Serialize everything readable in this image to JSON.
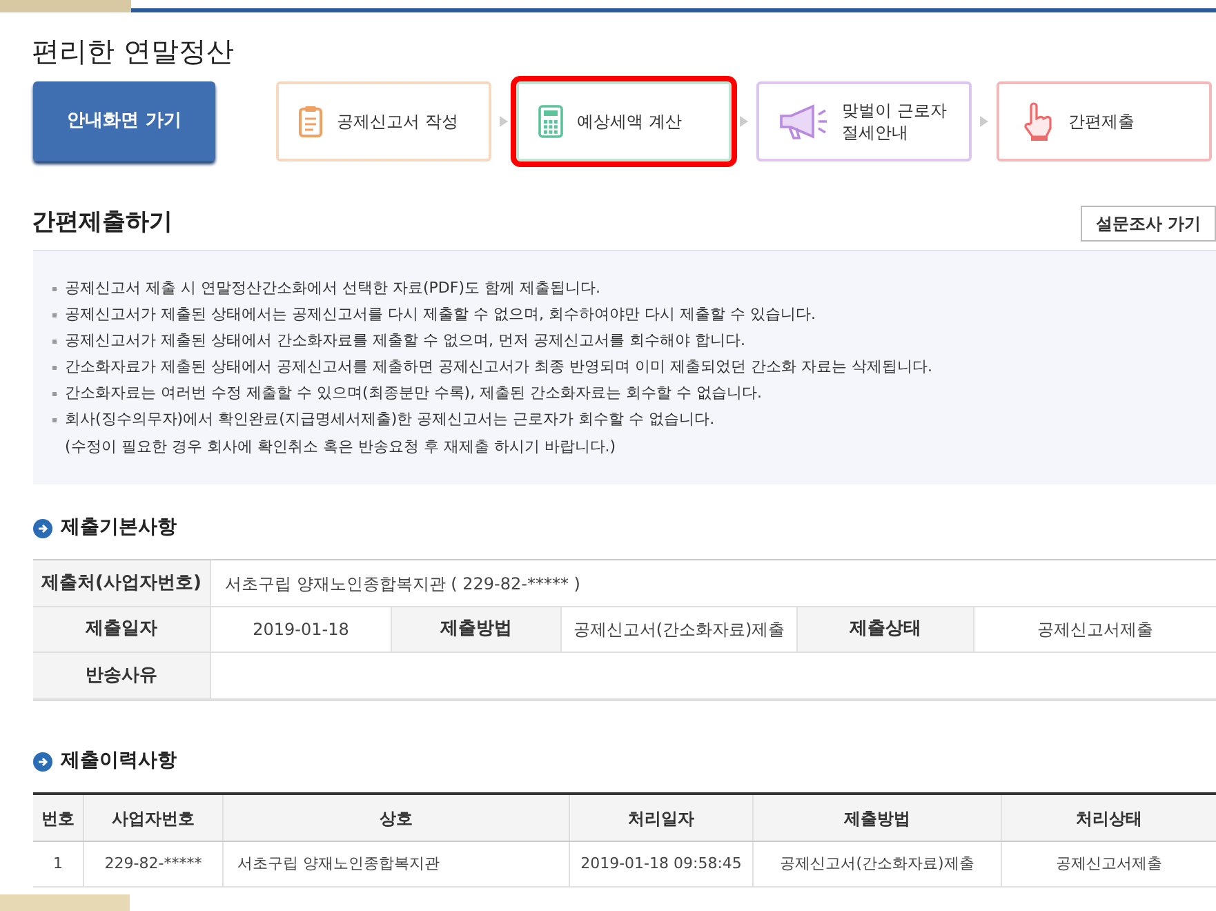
{
  "page_title": "편리한 연말정산",
  "home_button": "안내화면 가기",
  "steps": [
    {
      "label": "공제신고서 작성",
      "kind": "clipboard",
      "color": "#f7d9bf",
      "selected": false
    },
    {
      "label": "예상세액 계산",
      "kind": "calculator",
      "color": "#bfe6d4",
      "selected": true
    },
    {
      "label": "맞벌이 근로자\n절세안내",
      "kind": "megaphone",
      "color": "#dcc6f0",
      "selected": false
    },
    {
      "label": "간편제출",
      "kind": "hand",
      "color": "#f5b8b8",
      "selected": false
    }
  ],
  "section_title": "간편제출하기",
  "survey_button": "설문조사 가기",
  "notices": [
    "공제신고서 제출 시 연말정산간소화에서 선택한 자료(PDF)도 함께 제출됩니다.",
    "공제신고서가 제출된 상태에서는 공제신고서를 다시 제출할 수 없으며, 회수하여야만 다시 제출할 수 있습니다.",
    "공제신고서가 제출된 상태에서 간소화자료를 제출할 수 없으며, 먼저 공제신고서를 회수해야 합니다.",
    "간소화자료가 제출된 상태에서 공제신고서를 제출하면 공제신고서가 최종 반영되며 이미 제출되었던 간소화 자료는 삭제됩니다.",
    "간소화자료는 여러번 수정 제출할 수 있으며(최종분만 수록), 제출된 간소화자료는 회수할 수 없습니다.",
    "회사(징수의무자)에서 확인완료(지급명세서제출)한 공제신고서는 근로자가 회수할 수 없습니다."
  ],
  "notice_note": "(수정이 필요한 경우 회사에 확인취소 혹은 반송요청 후 재제출 하시기 바랍니다.)",
  "basic_info": {
    "title": "제출기본사항",
    "submitter_label": "제출처(사업자번호)",
    "submitter_value": "서초구립 양재노인종합복지관 ( 229-82-***** )",
    "date_label": "제출일자",
    "date_value": "2019-01-18",
    "method_label": "제출방법",
    "method_value": "공제신고서(간소화자료)제출",
    "status_label": "제출상태",
    "status_value": "공제신고서제출",
    "reason_label": "반송사유"
  },
  "history": {
    "title": "제출이력사항",
    "columns": [
      "번호",
      "사업자번호",
      "상호",
      "처리일자",
      "제출방법",
      "처리상태"
    ],
    "rows": [
      [
        "1",
        "229-82-*****",
        "서초구립 양재노인종합복지관",
        "2019-01-18 09:58:45",
        "공제신고서(간소화자료)제출",
        "공제신고서제출"
      ]
    ]
  }
}
